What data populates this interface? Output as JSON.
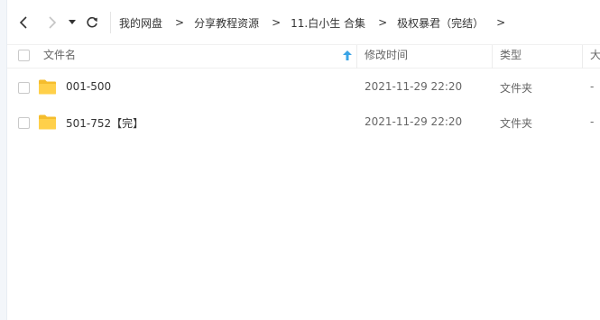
{
  "breadcrumb": [
    {
      "label": "我的网盘"
    },
    {
      "label": "分享教程资源"
    },
    {
      "label": "11.白小生 合集"
    },
    {
      "label": "极权暴君（完结）"
    }
  ],
  "breadcrumb_separator": ">",
  "columns": {
    "name": "文件名",
    "modified": "修改时间",
    "type": "类型",
    "size": "大"
  },
  "files": [
    {
      "name": "001-500",
      "modified": "2021-11-29 22:20",
      "type": "文件夹",
      "size": "-"
    },
    {
      "name": "501-752【完】",
      "modified": "2021-11-29 22:20",
      "type": "文件夹",
      "size": "-"
    }
  ],
  "colors": {
    "folder": "#ffd04a",
    "sort_arrow": "#3aa4e6",
    "icon": "#333333"
  },
  "icons": {
    "back": "chevron-left-icon",
    "forward": "chevron-right-icon",
    "history": "caret-down-icon",
    "refresh": "refresh-icon",
    "sort": "sort-up-arrow-icon",
    "folder": "folder-icon"
  }
}
